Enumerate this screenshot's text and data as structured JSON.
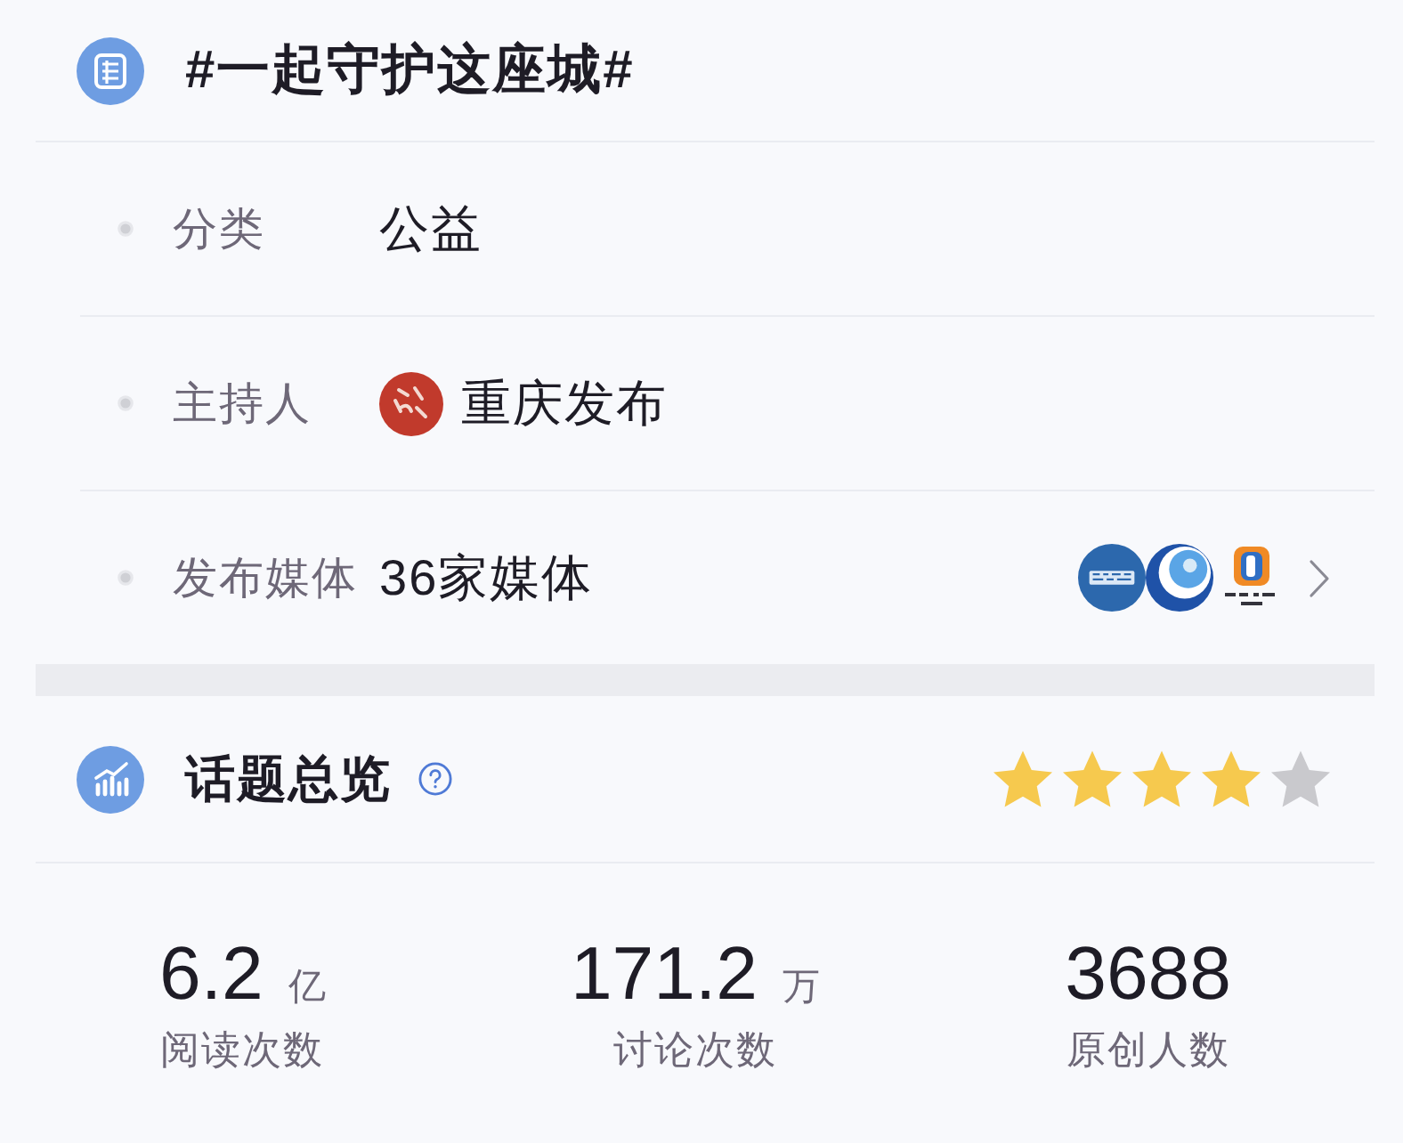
{
  "topic": {
    "title": "#一起守护这座城#"
  },
  "details": [
    {
      "kind": "text",
      "label": "分类",
      "value": "公益"
    },
    {
      "kind": "host",
      "label": "主持人",
      "value": "重庆发布"
    },
    {
      "kind": "media",
      "label": "发布媒体",
      "value": "36家媒体"
    }
  ],
  "overview": {
    "title": "话题总览",
    "stars": 4
  },
  "stats": [
    {
      "value": "6.2",
      "unit": "亿",
      "label": "阅读次数"
    },
    {
      "value": "171.2",
      "unit": "万",
      "label": "讨论次数"
    },
    {
      "value": "3688",
      "label": "原创人数"
    }
  ]
}
